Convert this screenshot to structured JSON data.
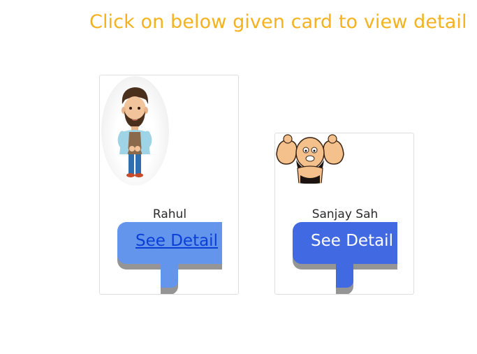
{
  "page": {
    "heading": "Click on below given card to view detail"
  },
  "cards": [
    {
      "name": "Rahul",
      "button_label": "See Detail",
      "button_color": "#6495ed",
      "avatar_icon": "cartoon-man-avatar"
    },
    {
      "name": "Sanjay Sah",
      "button_label": "See Detail",
      "button_color": "#4169e1",
      "avatar_icon": "cartoon-muscle-man-avatar"
    }
  ],
  "colors": {
    "heading": "#f5b21f",
    "button_shadow": "#959595"
  }
}
